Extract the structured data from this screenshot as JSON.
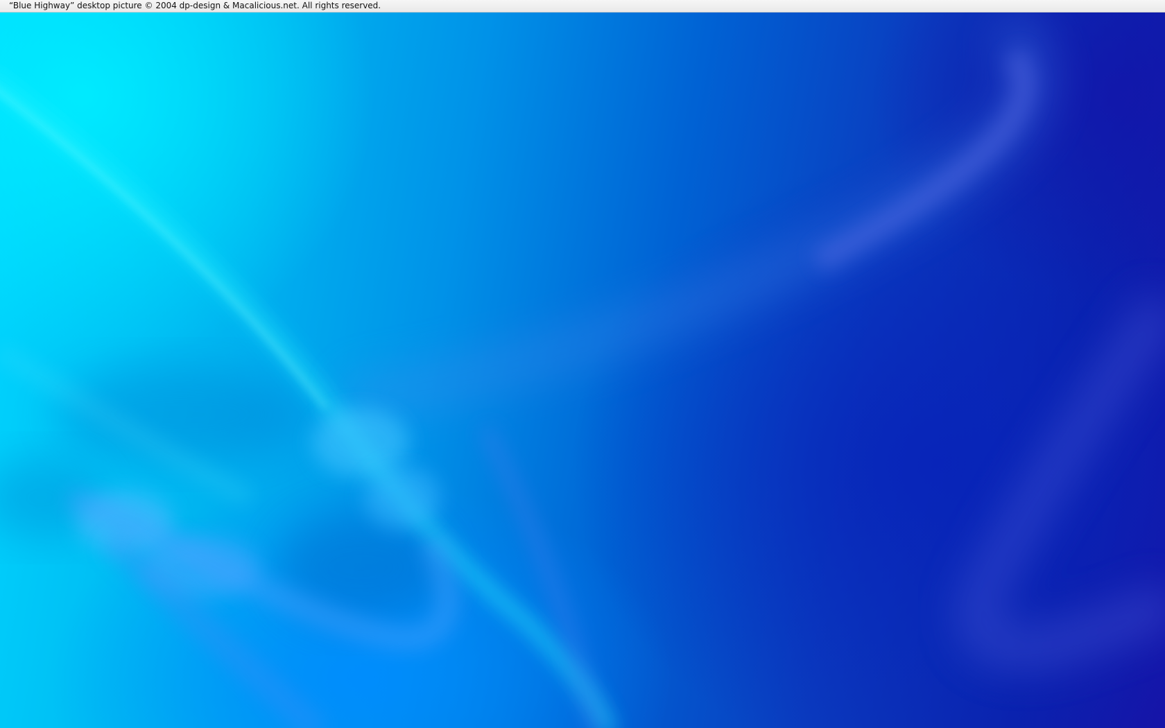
{
  "caption": {
    "text": "“Blue Highway” desktop picture © 2004 dp-design & Macalicious.net.  All rights reserved."
  },
  "colors": {
    "caption_background": "#efefef",
    "caption_text": "#111111",
    "wallpaper_light": "#00d8ff",
    "wallpaper_mid": "#0092e8",
    "wallpaper_dark": "#0a22ad"
  }
}
